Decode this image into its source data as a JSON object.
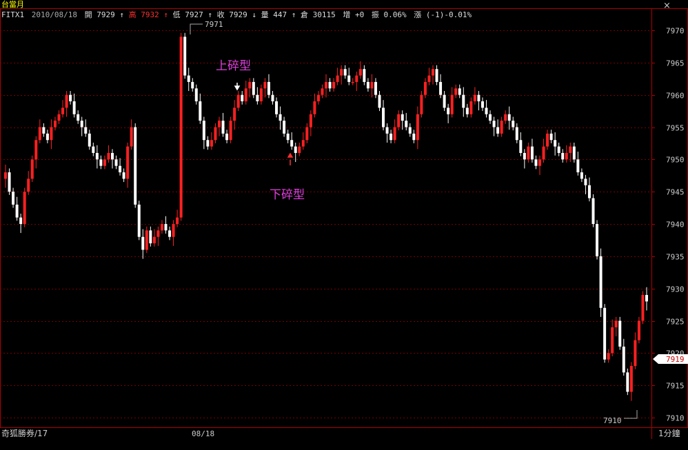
{
  "window": {
    "title": "台當月",
    "close_glyph": "×",
    "colors": {
      "title": "#ffff00",
      "frame": "#b00000",
      "grid": "#7a0000"
    }
  },
  "header": {
    "symbol": "FITX1",
    "date": "2010/08/18",
    "open_label": "開",
    "open_value": "7929",
    "high_label": "高",
    "high_value": "7932",
    "low_label": "低",
    "low_value": "7927",
    "close_label": "收",
    "close_value": "7929",
    "volume_label": "量",
    "volume_value": "447",
    "oi_label": "倉",
    "oi_value": "30115",
    "change_oi_label": "增",
    "change_oi_value": "+0",
    "amplitude_label": "振",
    "amplitude_value": "0.06%",
    "change_label": "漲",
    "change_value": "(-1)-0.01%",
    "up_arrow": "↑",
    "down_arrow": "↓"
  },
  "footer": {
    "left_label": "奇狐勝券/17",
    "date_label": "08/18",
    "interval_label": "1分鐘"
  },
  "annotations": {
    "upper_pattern": "上碎型",
    "lower_pattern": "下碎型",
    "color": "#e040e0"
  },
  "chart_data": {
    "type": "candlestick",
    "title": "",
    "xlabel": "",
    "ylabel": "",
    "ylim": [
      7909,
      7972
    ],
    "yticks": [
      7910,
      7915,
      7920,
      7925,
      7930,
      7935,
      7940,
      7945,
      7950,
      7955,
      7960,
      7965,
      7970
    ],
    "x_tick_labels": [
      "08/18"
    ],
    "grid": true,
    "grid_style": "dotted-horizontal",
    "last_price": "7919",
    "high_marker": "7971",
    "low_marker": "7910",
    "colors": {
      "up": "#ff2020",
      "down": "#ffffff",
      "axis_text": "#cccccc",
      "price_tag": "#ffffff"
    },
    "closes": [
      7948,
      7945,
      7943,
      7941,
      7940,
      7945,
      7947,
      7950,
      7953,
      7955,
      7954,
      7953,
      7955,
      7956,
      7957,
      7958,
      7960,
      7959,
      7957,
      7956,
      7955,
      7954,
      7952,
      7951,
      7950,
      7949,
      7950,
      7951,
      7950,
      7949,
      7948,
      7947,
      7952,
      7955,
      7943,
      7938,
      7936,
      7939,
      7937,
      7938,
      7939,
      7940,
      7939,
      7938,
      7940,
      7941,
      7969,
      7963,
      7962,
      7961,
      7959,
      7956,
      7953,
      7952,
      7953,
      7955,
      7956,
      7954,
      7953,
      7956,
      7958,
      7960,
      7959,
      7961,
      7962,
      7960,
      7959,
      7961,
      7962,
      7960,
      7959,
      7957,
      7956,
      7954,
      7953,
      7952,
      7951,
      7952,
      7953,
      7955,
      7957,
      7959,
      7960,
      7961,
      7962,
      7961,
      7962,
      7963,
      7964,
      7963,
      7962,
      7962,
      7963,
      7964,
      7962,
      7961,
      7962,
      7960,
      7958,
      7955,
      7954,
      7953,
      7955,
      7957,
      7956,
      7955,
      7954,
      7953,
      7957,
      7960,
      7962,
      7963,
      7964,
      7962,
      7960,
      7958,
      7957,
      7960,
      7961,
      7960,
      7958,
      7957,
      7959,
      7960,
      7959,
      7958,
      7957,
      7956,
      7955,
      7954,
      7956,
      7957,
      7956,
      7955,
      7953,
      7951,
      7950,
      7952,
      7950,
      7949,
      7950,
      7952,
      7954,
      7953,
      7952,
      7951,
      7950,
      7951,
      7952,
      7950,
      7948,
      7947,
      7946,
      7944,
      7940,
      7935,
      7927,
      7919,
      7920,
      7924,
      7925,
      7921,
      7917,
      7914,
      7918,
      7922,
      7925,
      7929,
      7928
    ]
  }
}
